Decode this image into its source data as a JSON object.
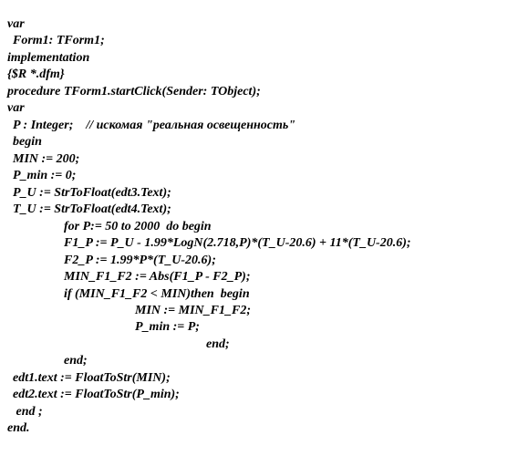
{
  "lines": [
    {
      "cls": "",
      "text": "var"
    },
    {
      "cls": "i1",
      "text": "Form1: TForm1;"
    },
    {
      "cls": "",
      "text": "implementation"
    },
    {
      "cls": "",
      "text": "{$R *.dfm}"
    },
    {
      "cls": "",
      "text": "procedure TForm1.startClick(Sender: TObject);"
    },
    {
      "cls": "",
      "text": "var"
    },
    {
      "cls": "i1",
      "text": "P : Integer;    // искомая \"реальная освещенность\""
    },
    {
      "cls": "i1",
      "text": "begin"
    },
    {
      "cls": "i1",
      "text": "MIN := 200;"
    },
    {
      "cls": "i1",
      "text": "P_min := 0;"
    },
    {
      "cls": "i1",
      "text": "P_U := StrToFloat(edt3.Text);"
    },
    {
      "cls": "i1",
      "text": "T_U := StrToFloat(edt4.Text);"
    },
    {
      "cls": "i2",
      "text": "for P:= 50 to 2000  do begin"
    },
    {
      "cls": "i2",
      "text": "F1_P := P_U - 1.99*LogN(2.718,P)*(T_U-20.6) + 11*(T_U-20.6);"
    },
    {
      "cls": "i2",
      "text": "F2_P := 1.99*P*(T_U-20.6);"
    },
    {
      "cls": "i2",
      "text": "MIN_F1_F2 := Abs(F1_P - F2_P);"
    },
    {
      "cls": "i2",
      "text": "if (MIN_F1_F2 < MIN)then  begin"
    },
    {
      "cls": "i3",
      "text": "MIN := MIN_F1_F2;"
    },
    {
      "cls": "i3",
      "text": "P_min := P;"
    },
    {
      "cls": "i4",
      "text": "end;"
    },
    {
      "cls": "i2",
      "text": "end;"
    },
    {
      "cls": "i1",
      "text": "edt1.text := FloatToStr(MIN);"
    },
    {
      "cls": "i1",
      "text": "edt2.text := FloatToStr(P_min);"
    },
    {
      "cls": "i1",
      "text": " end ;"
    },
    {
      "cls": "",
      "text": "end."
    }
  ]
}
